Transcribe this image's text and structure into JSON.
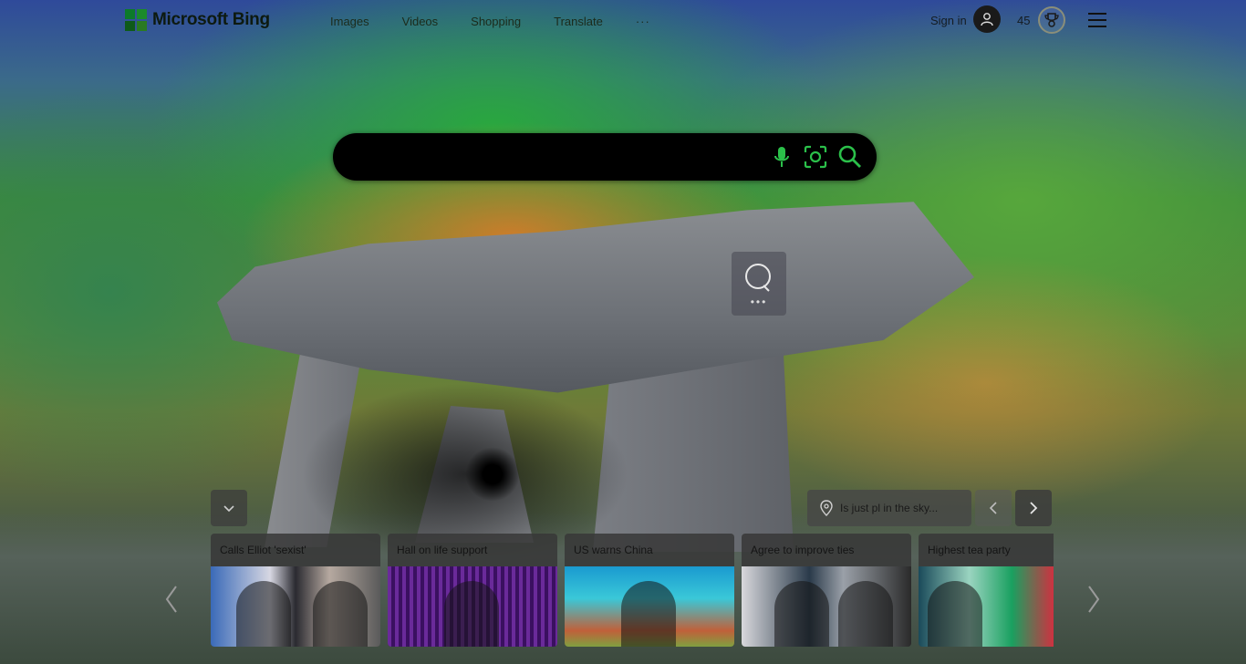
{
  "header": {
    "brand": "Microsoft Bing",
    "logo_colors": [
      "#0c7a2a",
      "#1b8a2a",
      "#0e5a1a",
      "#2a7a22"
    ],
    "nav": [
      "Images",
      "Videos",
      "Shopping",
      "Translate"
    ],
    "more": "···",
    "signin": "Sign in",
    "points": "45"
  },
  "search": {
    "placeholder": "",
    "icons": [
      "microphone-icon",
      "visual-search-icon",
      "search-icon"
    ]
  },
  "hotspot": {
    "dots": "•••"
  },
  "info": {
    "text": "Is just pl in the sky..."
  },
  "cards": [
    {
      "title": "Calls Elliot 'sexist'"
    },
    {
      "title": "Hall on life support"
    },
    {
      "title": "US warns China"
    },
    {
      "title": "Agree to improve ties"
    },
    {
      "title": "Highest tea party"
    }
  ],
  "colors": {
    "search_bg": "#000000",
    "icon_green": "#2bc04a"
  }
}
